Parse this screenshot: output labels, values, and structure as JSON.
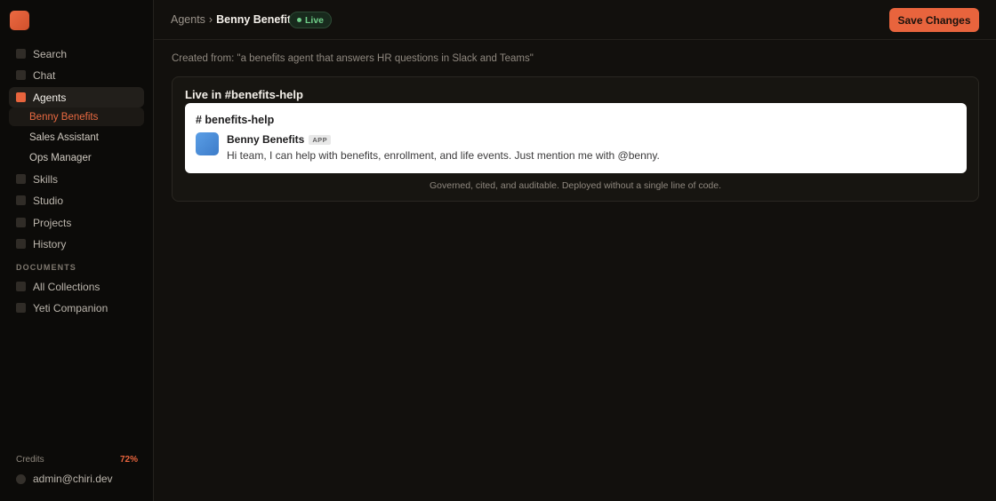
{
  "sidebar": {
    "nav": [
      {
        "id": "search",
        "label": "Search",
        "active": false
      },
      {
        "id": "chat",
        "label": "Chat",
        "active": false
      },
      {
        "id": "agents",
        "label": "Agents",
        "active": true
      }
    ],
    "agents": [
      {
        "label": "Benny Benefits",
        "active": true
      },
      {
        "label": "Sales Assistant",
        "active": false
      },
      {
        "label": "Ops Manager",
        "active": false
      }
    ],
    "nav_lower": [
      {
        "id": "skills",
        "label": "Skills"
      },
      {
        "id": "studio",
        "label": "Studio"
      },
      {
        "id": "projects",
        "label": "Projects"
      },
      {
        "id": "history",
        "label": "History"
      }
    ],
    "documents_label": "DOCUMENTS",
    "documents": [
      {
        "id": "all-collections",
        "label": "All Collections"
      },
      {
        "id": "yeti-companion",
        "label": "Yeti Companion"
      }
    ],
    "credits_label": "Credits",
    "credits_value": "72%",
    "account_email": "admin@chiri.dev"
  },
  "header": {
    "breadcrumb_root": "Agents",
    "breadcrumb_sep": "›",
    "breadcrumb_current": "Benny Benefits",
    "status": "Live",
    "save_label": "Save Changes"
  },
  "main": {
    "created_from": "Created from: \"a benefits agent that answers HR questions in Slack and Teams\"",
    "panel_title": "Live in #benefits-help",
    "channel": "# benefits-help",
    "bot_name": "Benny Benefits",
    "app_tag": "APP",
    "message": "Hi team, I can help with benefits, enrollment, and life events. Just mention me with @benny.",
    "footer": "Governed, cited, and auditable. Deployed without a single line of code."
  },
  "colors": {
    "accent": "#e8643d",
    "live": "#6fcf89",
    "background": "#12100d"
  }
}
